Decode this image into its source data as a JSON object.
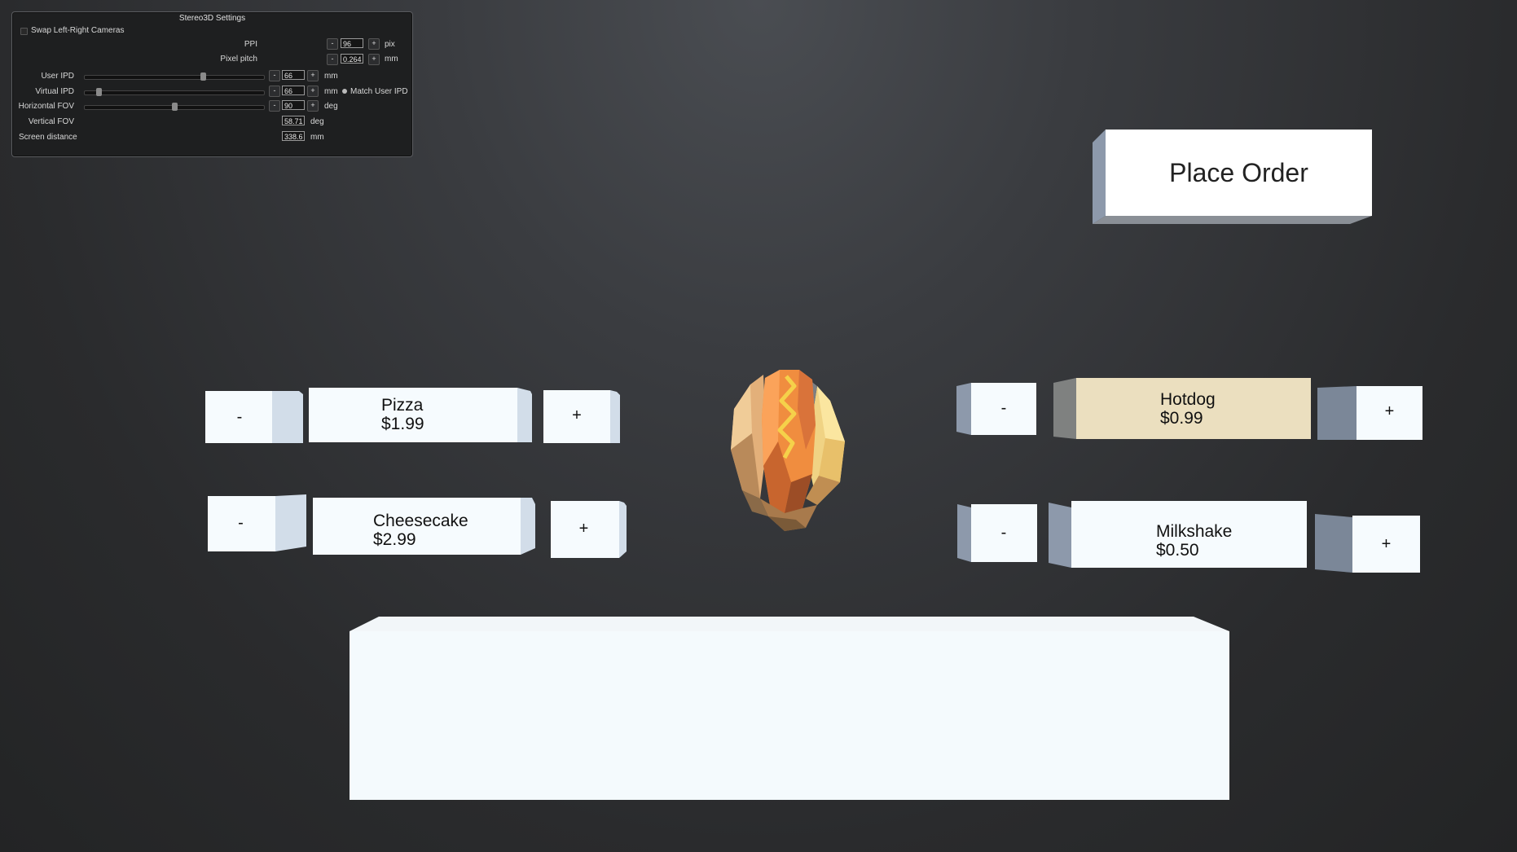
{
  "settings_panel": {
    "title": "Stereo3D Settings",
    "swap_label": "Swap Left-Right Cameras",
    "ppi": {
      "label": "PPI",
      "value": "96",
      "unit": "pix",
      "minus": "-",
      "plus": "+"
    },
    "pixel_pitch": {
      "label": "Pixel pitch",
      "value": "0.264",
      "unit": "mm",
      "minus": "-",
      "plus": "+"
    },
    "user_ipd": {
      "label": "User IPD",
      "value": "66",
      "unit": "mm",
      "minus": "-",
      "plus": "+",
      "slider_fraction": 0.66
    },
    "virtual_ipd": {
      "label": "Virtual IPD",
      "value": "66",
      "unit": "mm",
      "minus": "-",
      "plus": "+",
      "slider_fraction": 0.08,
      "match_label": "Match User IPD"
    },
    "horizontal_fov": {
      "label": "Horizontal FOV",
      "value": "90",
      "unit": "deg",
      "minus": "-",
      "plus": "+",
      "slider_fraction": 0.5
    },
    "vertical_fov": {
      "label": "Vertical FOV",
      "value": "58.71",
      "unit": "deg"
    },
    "screen_distance": {
      "label": "Screen distance",
      "value": "338.6",
      "unit": "mm"
    }
  },
  "order_button": {
    "label": "Place Order"
  },
  "menu": {
    "pizza": {
      "name": "Pizza",
      "price": "$1.99",
      "minus": "-",
      "plus": "+"
    },
    "cheesecake": {
      "name": "Cheesecake",
      "price": "$2.99",
      "minus": "-",
      "plus": "+"
    },
    "hotdog": {
      "name": "Hotdog",
      "price": "$0.99",
      "minus": "-",
      "plus": "+",
      "selected": true,
      "highlight_color": "#ebdfbf"
    },
    "milkshake": {
      "name": "Milkshake",
      "price": "$0.50",
      "minus": "-",
      "plus": "+"
    }
  },
  "preview_model": {
    "icon": "hotdog-model"
  },
  "colors": {
    "background": "#2a2b2d",
    "box_face": "#f6fbfe",
    "box_side": "#a7b3c4"
  }
}
